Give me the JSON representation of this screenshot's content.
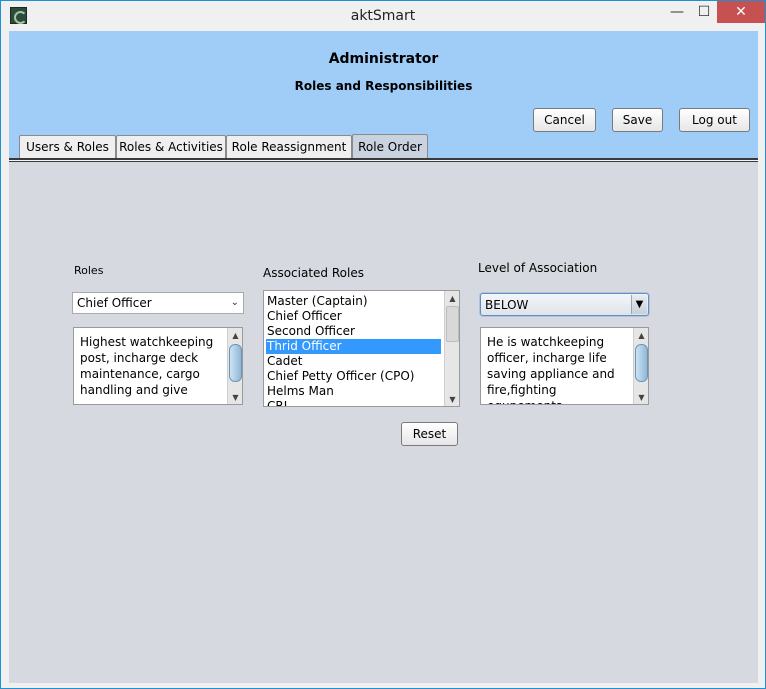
{
  "window": {
    "title": "aktSmart",
    "minimize": "—",
    "maximize": "☐",
    "close": "✕"
  },
  "header": {
    "title": "Administrator",
    "subtitle": "Roles and Responsibilities",
    "cancel_label": "Cancel",
    "save_label": "Save",
    "logout_label": "Log out",
    "background_color": "#9fcdf8"
  },
  "tabs": [
    {
      "label": "Users & Roles"
    },
    {
      "label": "Roles & Activities"
    },
    {
      "label": "Role Reassignment"
    },
    {
      "label": "Role Order",
      "active": true
    }
  ],
  "roles": {
    "label": "Roles",
    "selected": "Chief Officer",
    "description": "Highest watchkeeping post, incharge deck maintenance, cargo handling and give"
  },
  "associated_roles": {
    "label": "Associated Roles",
    "items": [
      "Master (Captain)",
      "Chief Officer",
      "Second Officer",
      "Thrid Officer",
      "Cadet",
      "Chief Petty Officer (CPO)",
      "Helms Man",
      "CRJ"
    ],
    "selected_index": 3
  },
  "level": {
    "label": "Level of Association",
    "selected": "BELOW",
    "description": "He is watchkeeping officer, incharge life saving appliance and fire,fighting equpements,"
  },
  "reset_label": "Reset",
  "icons": {
    "scroll_up": "▲",
    "scroll_down": "▼",
    "dropdown": "⌄",
    "dropdown_solid": "▼"
  }
}
